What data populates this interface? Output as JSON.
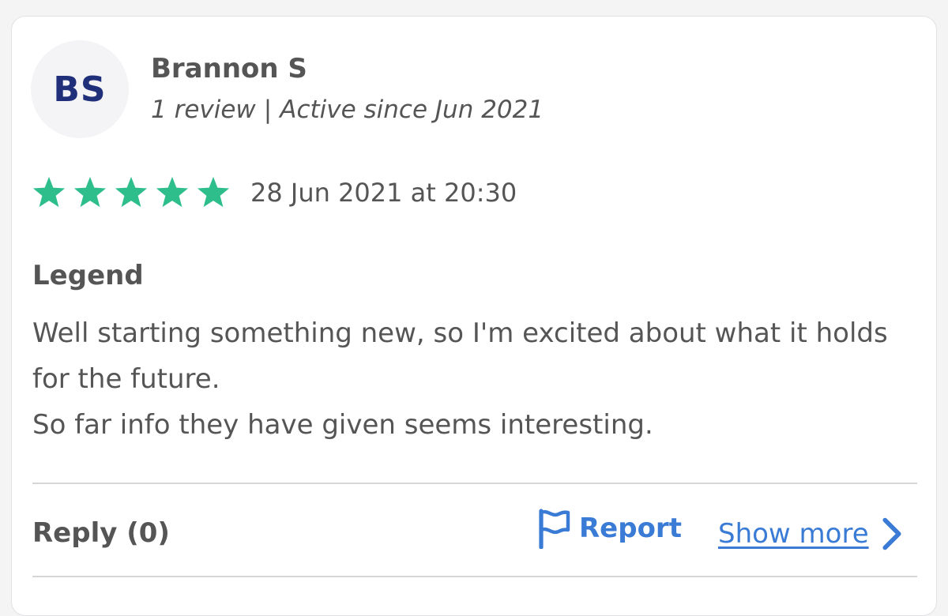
{
  "reviewer": {
    "initials": "BS",
    "name": "Brannon S",
    "review_count": "1 review",
    "separator": "|",
    "active_since": "Active since Jun 2021"
  },
  "review": {
    "rating": 5,
    "max_rating": 5,
    "date": "28 Jun 2021 at 20:30",
    "title": "Legend",
    "body_line_1": "Well starting something new, so I'm excited about what it holds for the future.",
    "body_line_2": "So far info they have given seems interesting."
  },
  "actions": {
    "reply_label": "Reply (0)",
    "report_label": "Report",
    "show_more_label": "Show more"
  },
  "icons": {
    "star": "star-icon",
    "report": "flag-icon",
    "show_more": "chevron-right-icon"
  },
  "colors": {
    "star": "#2dbe8c",
    "link": "#3a7bd5",
    "initials": "#1f2f7a",
    "text": "#555555"
  }
}
